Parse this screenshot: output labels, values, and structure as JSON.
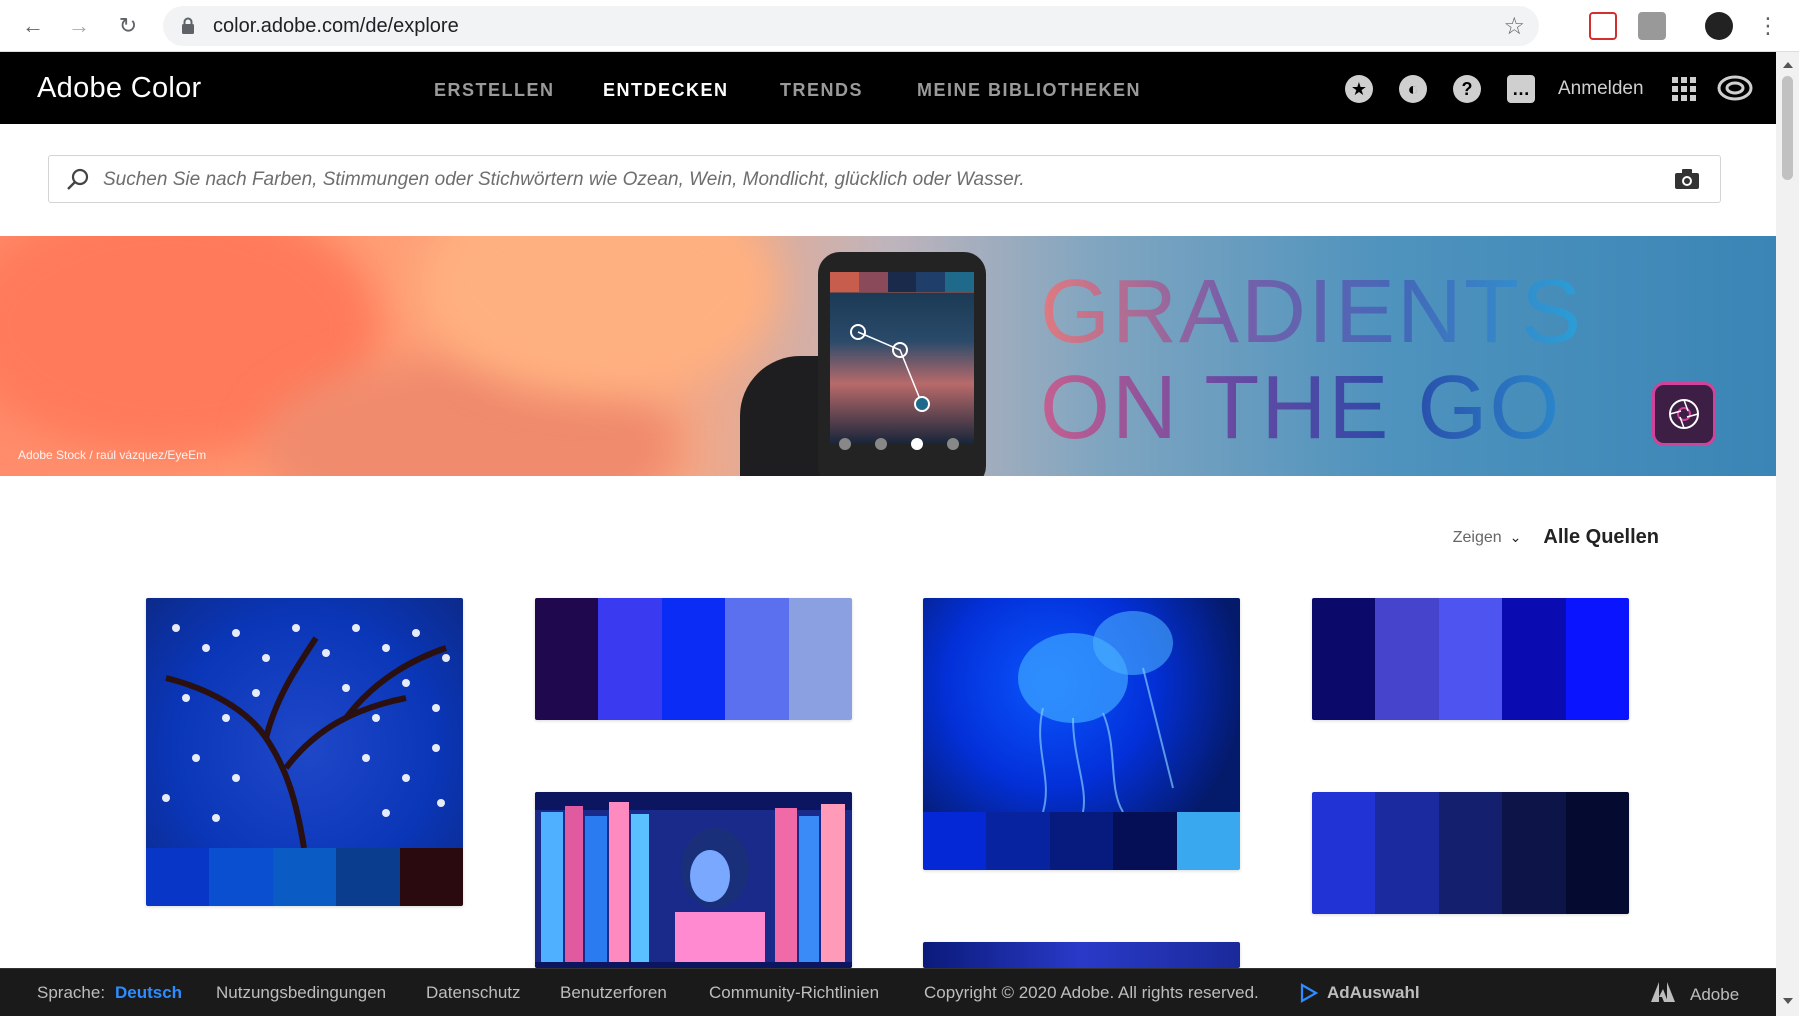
{
  "browser": {
    "url": "color.adobe.com/de/explore"
  },
  "header": {
    "brand": "Adobe Color",
    "nav": [
      "ERSTELLEN",
      "ENTDECKEN",
      "TRENDS",
      "MEINE BIBLIOTHEKEN"
    ],
    "active_nav": "ENTDECKEN",
    "signin": "Anmelden"
  },
  "search": {
    "placeholder": "Suchen Sie nach Farben, Stimmungen oder Stichwörtern wie Ozean, Wein, Mondlicht, glücklich oder Wasser."
  },
  "hero": {
    "title_line1": "GRADIENTS",
    "title_line2": "ON THE GO",
    "credit": "Adobe Stock / raúl vázquez/EyeEm"
  },
  "filter": {
    "label": "Zeigen",
    "value": "Alle Quellen"
  },
  "footer": {
    "language_label": "Sprache:",
    "language_value": "Deutsch",
    "terms": "Nutzungsbedingungen",
    "privacy": "Datenschutz",
    "forums": "Benutzerforen",
    "community": "Community-Richtlinien",
    "copyright": "Copyright © 2020 Adobe. All rights reserved.",
    "adchoice": "AdAuswahl",
    "adobe": "Adobe"
  },
  "colors": {
    "accent": "#2d8cff",
    "card1_strip": [
      "#0836c7",
      "#0a4fcf",
      "#0a5cc4",
      "#0b3d8f",
      "#2a0a0f"
    ],
    "card2_palette": [
      "#20084f",
      "#3a3bf0",
      "#0a2cf5",
      "#5b70ee",
      "#8aa0e0"
    ],
    "card3_strip": [
      "#0528d6",
      "#0723a0",
      "#071b7e",
      "#050f55",
      "#3aa8ee"
    ],
    "card4_palette": [
      "#0b0a6b",
      "#4644cc",
      "#4d54f0",
      "#0a0bb1",
      "#0a14ff"
    ],
    "card5_palette": [
      "#2233d5",
      "#1c2aa0",
      "#14206e",
      "#0d1447",
      "#050a30"
    ]
  }
}
